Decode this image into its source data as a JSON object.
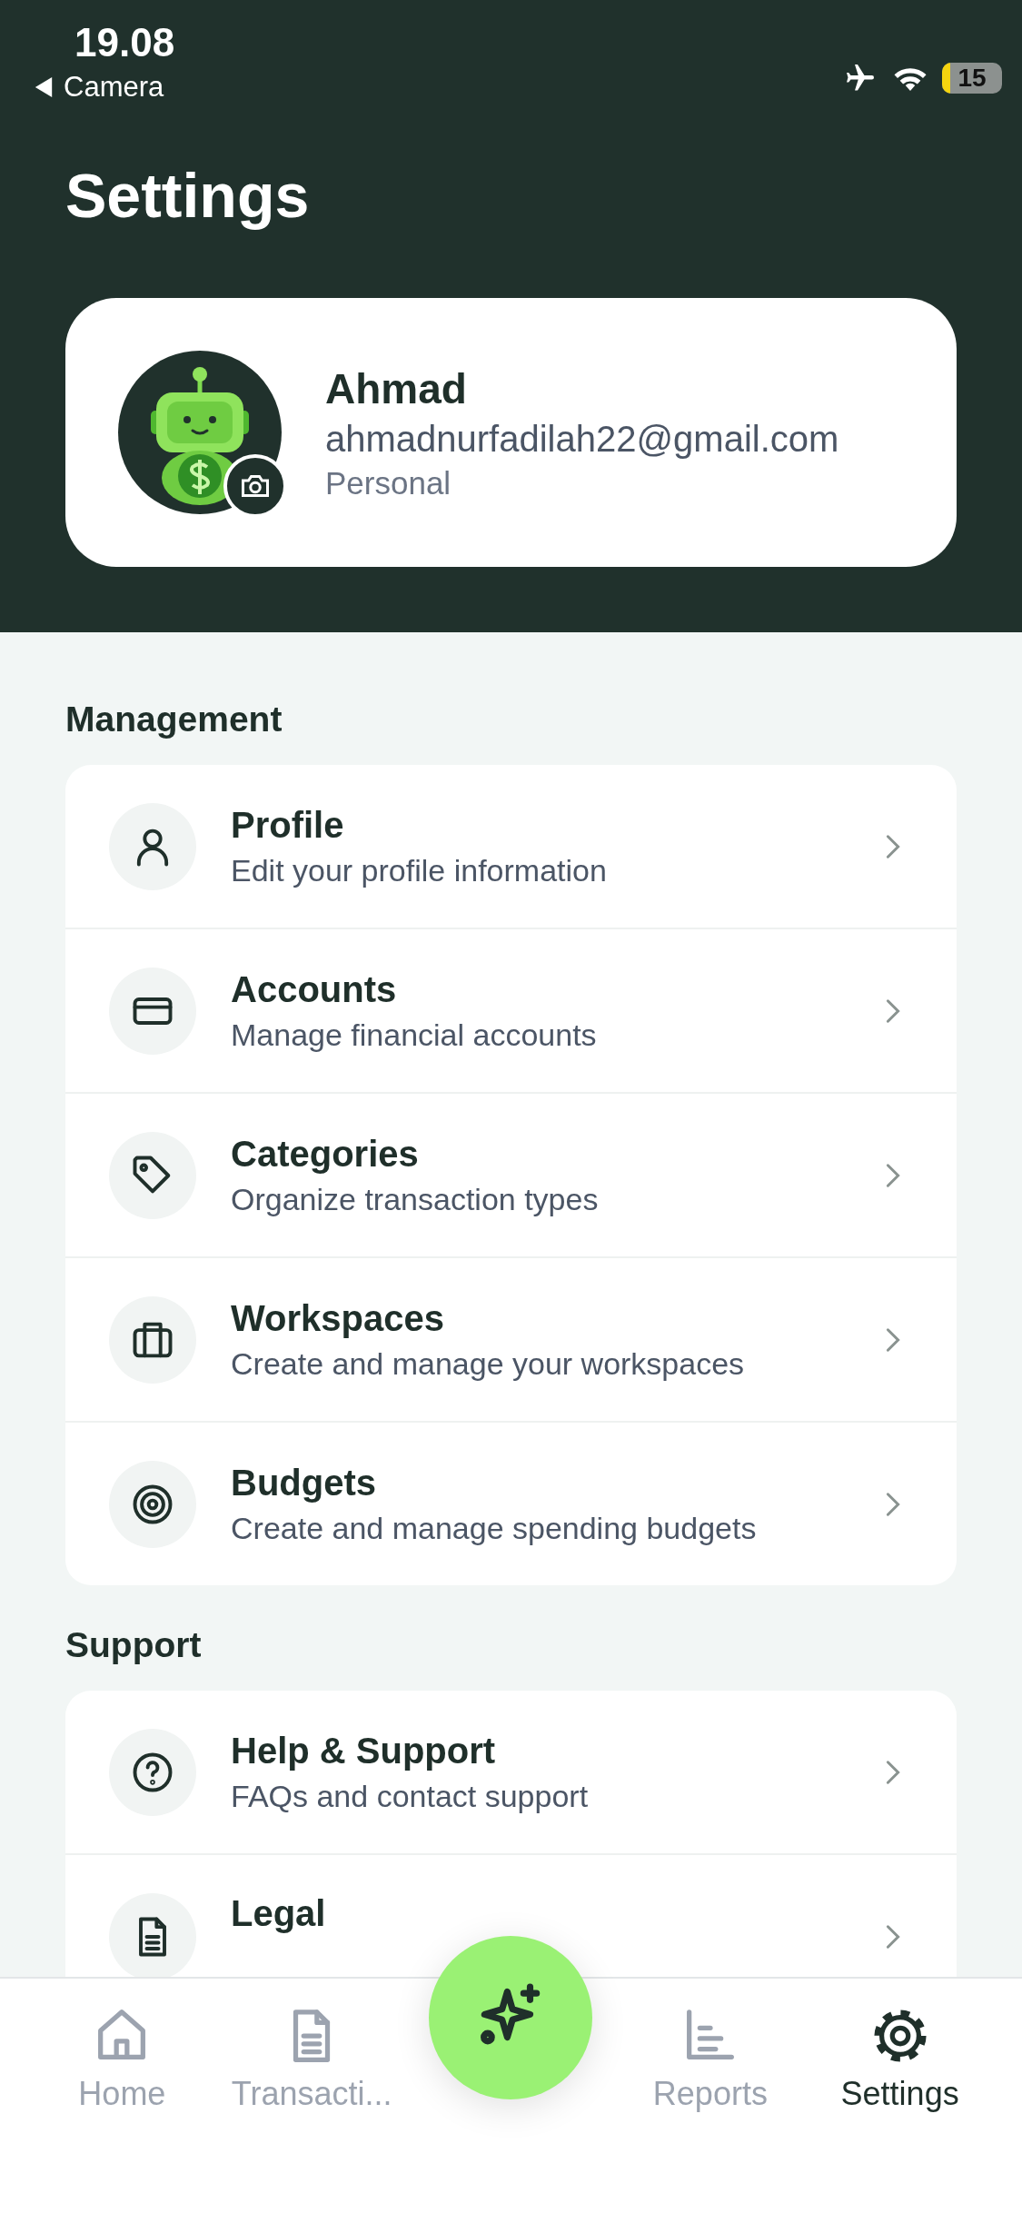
{
  "status_bar": {
    "time": "19.08",
    "back_label": "Camera",
    "battery": "15"
  },
  "title": "Settings",
  "profile": {
    "name": "Ahmad",
    "email": "ahmadnurfadilah22@gmail.com",
    "plan": "Personal"
  },
  "sections": [
    {
      "title": "Management",
      "items": [
        {
          "title": "Profile",
          "subtitle": "Edit your profile information"
        },
        {
          "title": "Accounts",
          "subtitle": "Manage financial accounts"
        },
        {
          "title": "Categories",
          "subtitle": "Organize transaction types"
        },
        {
          "title": "Workspaces",
          "subtitle": "Create and manage your workspaces"
        },
        {
          "title": "Budgets",
          "subtitle": "Create and manage spending budgets"
        }
      ]
    },
    {
      "title": "Support",
      "items": [
        {
          "title": "Help & Support",
          "subtitle": "FAQs and contact support"
        },
        {
          "title": "Legal"
        }
      ]
    }
  ],
  "nav": [
    {
      "label": "Home",
      "selected": false
    },
    {
      "label": "Transacti...",
      "selected": false
    },
    {
      "label": "Reports",
      "selected": false
    },
    {
      "label": "Settings",
      "selected": true
    }
  ]
}
